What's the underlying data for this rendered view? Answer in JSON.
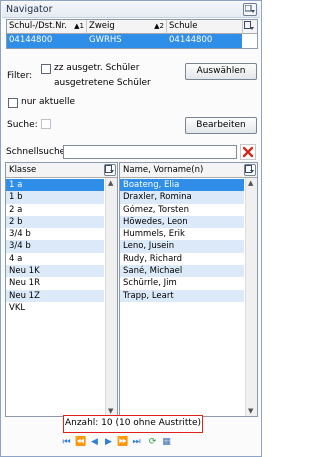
{
  "panel": {
    "title": "Navigator"
  },
  "grid": {
    "headers": [
      {
        "label": "Schul-/Dst.Nr.",
        "sort": "1"
      },
      {
        "label": "Zweig",
        "sort": "2"
      },
      {
        "label": "Schule",
        "sort": ""
      }
    ],
    "row": [
      "04144800",
      "GWRHS",
      "04144800"
    ]
  },
  "filter": {
    "label": "Filter:",
    "checkbox_label_line1": "zz ausgetr. Schüler",
    "checkbox_label_line2": "ausgetretene Schüler",
    "button": "Auswählen",
    "only_current": "nur aktuelle"
  },
  "search": {
    "label": "Suche:",
    "button": "Bearbeiten"
  },
  "quicksearch": {
    "label": "Schnellsuche",
    "value": ""
  },
  "classes": {
    "header": "Klasse",
    "items": [
      "1 a",
      "1 b",
      "2 a",
      "2 b",
      "3/4 b",
      "3/4 b",
      "4 a",
      "Neu 1K",
      "Neu 1R",
      "Neu 1Z",
      "VKL"
    ]
  },
  "students": {
    "header": "Name, Vorname(n)",
    "items": [
      "Boateng, Elia",
      "Draxler, Romina",
      "Gómez, Torsten",
      "Höwedes, Leon",
      "Hummels, Erik",
      "Leno, Jusein",
      "Rudy, Richard",
      "Sané, Michael",
      "Schürrle, Jim",
      "Trapp, Leart"
    ]
  },
  "footer": {
    "count": "Anzahl: 10 (10 ohne Austritte)"
  },
  "colors": {
    "selection": "#2f8ee8",
    "alt_row": "#dbe9f9",
    "highlight_border": "#e0201c"
  }
}
